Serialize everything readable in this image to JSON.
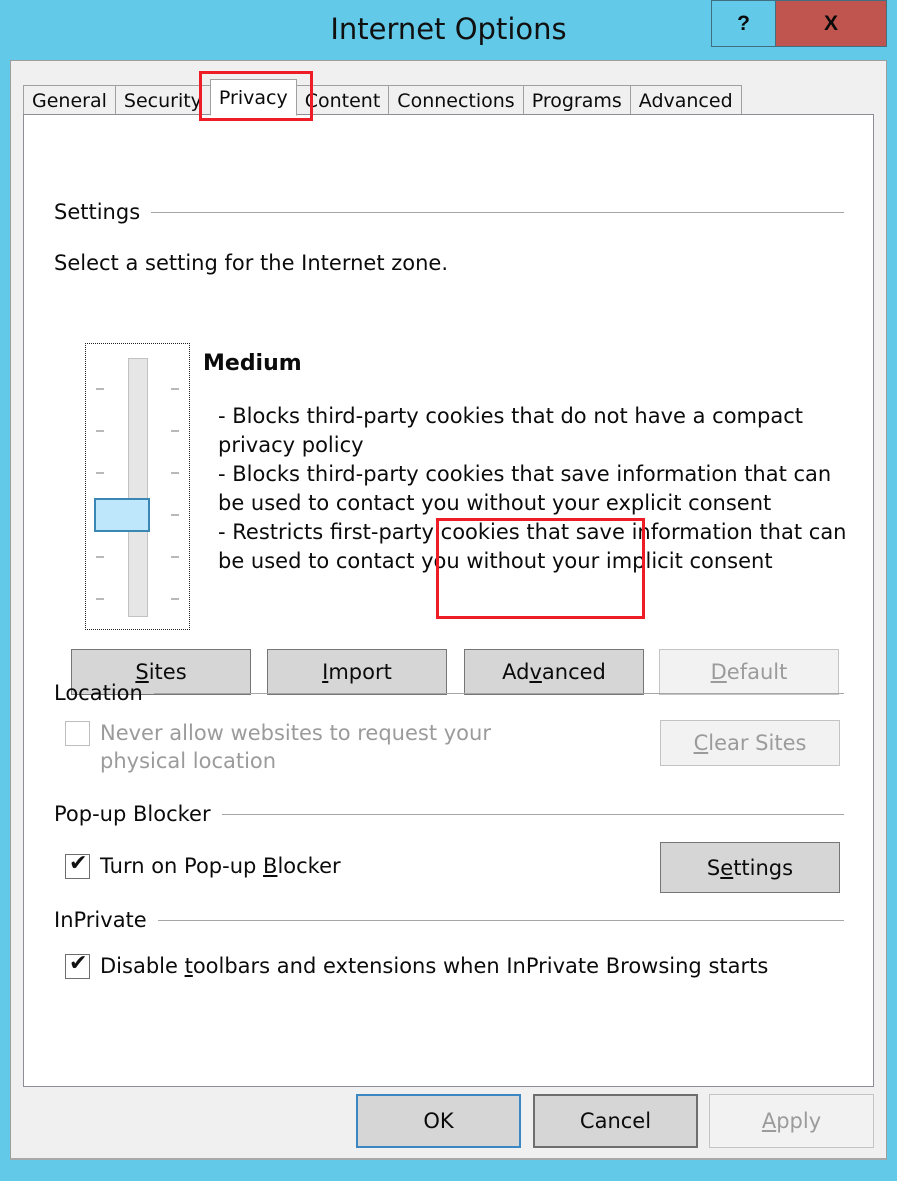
{
  "window": {
    "title": "Internet Options",
    "help_label": "?",
    "close_label": "X",
    "frame_color": "#62c9e8",
    "close_color": "#bf554e"
  },
  "tabs": [
    {
      "label": "General",
      "active": false
    },
    {
      "label": "Security",
      "active": false
    },
    {
      "label": "Privacy",
      "active": true
    },
    {
      "label": "Content",
      "active": false
    },
    {
      "label": "Connections",
      "active": false
    },
    {
      "label": "Programs",
      "active": false
    },
    {
      "label": "Advanced",
      "active": false
    }
  ],
  "settings_group": {
    "header": "Settings",
    "instruction": "Select a setting for the Internet zone.",
    "zone_level": "Medium",
    "zone_description": "- Blocks third-party cookies that do not have a compact privacy policy\n- Blocks third-party cookies that save information that can be used to contact you without your explicit consent\n- Restricts first-party cookies that save information that can be used to contact you without your implicit consent",
    "slider": {
      "name": "privacy-level-slider",
      "tick_count": 6,
      "thumb_position_index": 4,
      "thumb_color": "#bfe7fb",
      "thumb_border_color": "#3a87b5"
    },
    "buttons": [
      {
        "label": "Sites",
        "accel": "S",
        "disabled": false
      },
      {
        "label": "Import",
        "accel": "I",
        "disabled": false
      },
      {
        "label": "Advanced",
        "accel": "v",
        "disabled": false,
        "highlighted": true
      },
      {
        "label": "Default",
        "accel": "D",
        "disabled": true
      }
    ]
  },
  "location_group": {
    "header": "Location",
    "checkbox_label": "Never allow websites to request your\nphysical location",
    "checkbox_accel": "l",
    "checkbox_checked": false,
    "checkbox_disabled": true,
    "button": {
      "label": "Clear Sites",
      "accel": "C",
      "disabled": true
    }
  },
  "popup_group": {
    "header": "Pop-up Blocker",
    "checkbox_label": "Turn on Pop-up Blocker",
    "checkbox_accel": "B",
    "checkbox_checked": true,
    "checkmark": "✔",
    "button": {
      "label": "Settings",
      "accel": "e",
      "disabled": false
    }
  },
  "inprivate_group": {
    "header": "InPrivate",
    "checkbox_label": "Disable toolbars and extensions when InPrivate Browsing starts",
    "checkbox_accel": "t",
    "checkbox_checked": true,
    "checkmark": "✔"
  },
  "footer": {
    "ok_label": "OK",
    "cancel_label": "Cancel",
    "apply_label": "Apply",
    "apply_accel": "A",
    "apply_disabled": true
  },
  "annotations": {
    "accent_color": "#ee1c25",
    "targets": [
      "privacy-tab",
      "advanced-button"
    ]
  }
}
